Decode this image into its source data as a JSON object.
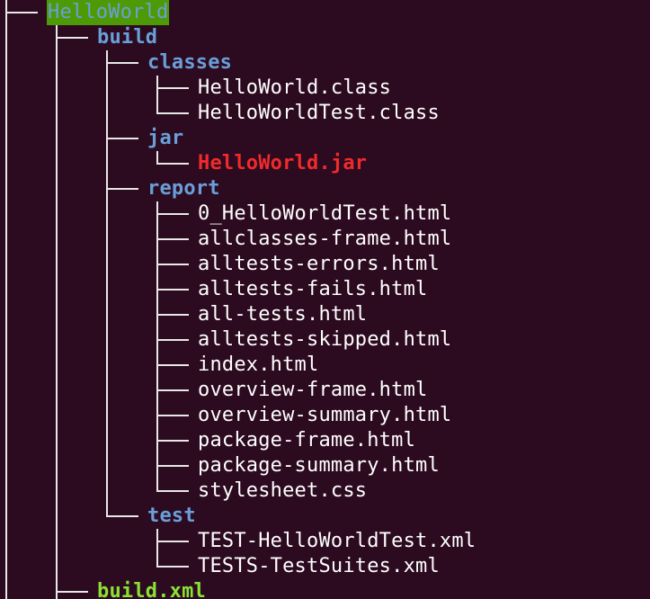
{
  "colors": {
    "background": "#2c0a20",
    "directory": "#6a9fd8",
    "file": "#ffffff",
    "archive": "#ef2b2b",
    "build_file": "#8ae234",
    "root_highlight": "#4e9a06"
  },
  "tree": {
    "root": "HelloWorld",
    "build": {
      "label": "build",
      "classes": {
        "label": "classes",
        "files": [
          "HelloWorld.class",
          "HelloWorldTest.class"
        ]
      },
      "jar": {
        "label": "jar",
        "files": [
          "HelloWorld.jar"
        ]
      },
      "report": {
        "label": "report",
        "files": [
          "0_HelloWorldTest.html",
          "allclasses-frame.html",
          "alltests-errors.html",
          "alltests-fails.html",
          "all-tests.html",
          "alltests-skipped.html",
          "index.html",
          "overview-frame.html",
          "overview-summary.html",
          "package-frame.html",
          "package-summary.html",
          "stylesheet.css"
        ]
      },
      "test": {
        "label": "test",
        "files": [
          "TEST-HelloWorldTest.xml",
          "TESTS-TestSuites.xml"
        ]
      }
    },
    "build_xml": "build.xml"
  }
}
